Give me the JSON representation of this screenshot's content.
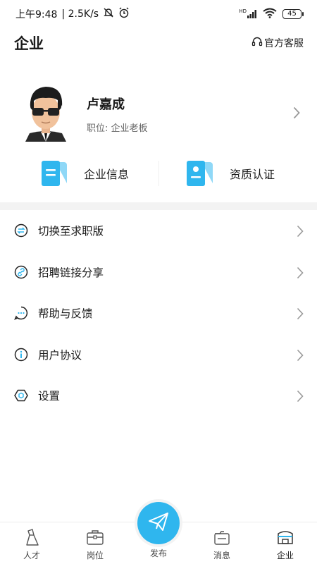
{
  "status_bar": {
    "time": "上午9:48",
    "speed": "| 2.5K/s",
    "network": "HD",
    "battery": "45"
  },
  "header": {
    "title": "企业",
    "service_label": "官方客服"
  },
  "profile": {
    "name": "卢嘉成",
    "role": "职位: 企业老板"
  },
  "quick_actions": [
    {
      "label": "企业信息",
      "icon": "document-icon"
    },
    {
      "label": "资质认证",
      "icon": "id-card-icon"
    }
  ],
  "menu": [
    {
      "label": "切换至求职版",
      "icon": "switch-icon"
    },
    {
      "label": "招聘链接分享",
      "icon": "link-icon"
    },
    {
      "label": "帮助与反馈",
      "icon": "chat-bubble-icon"
    },
    {
      "label": "用户协议",
      "icon": "info-icon"
    },
    {
      "label": "设置",
      "icon": "settings-hexagon-icon"
    }
  ],
  "tabbar": {
    "tabs": [
      {
        "label": "人才",
        "icon": "talent-icon"
      },
      {
        "label": "岗位",
        "icon": "briefcase-icon"
      },
      {
        "label": "发布",
        "icon": "paper-plane-icon"
      },
      {
        "label": "消息",
        "icon": "message-icon"
      },
      {
        "label": "企业",
        "icon": "company-icon",
        "active": true
      }
    ]
  },
  "colors": {
    "accent": "#2fb6ee",
    "icon_light": "#8fd8f7",
    "divider": "#f3f3f3"
  }
}
